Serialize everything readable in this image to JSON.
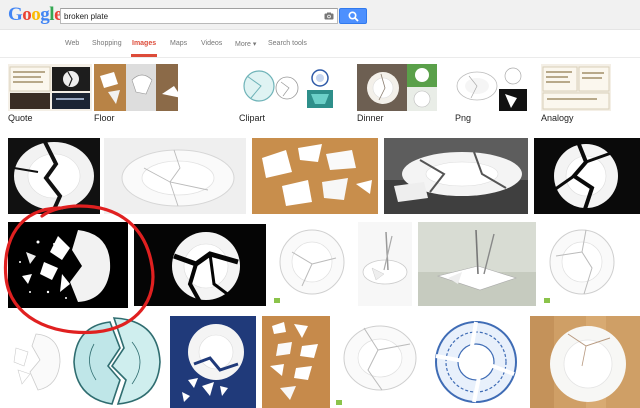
{
  "logo": {
    "letters": [
      "G",
      "o",
      "o",
      "g",
      "l",
      "e"
    ],
    "colors": [
      "#4285f4",
      "#ea4335",
      "#fbbc05",
      "#4285f4",
      "#34a853",
      "#ea4335"
    ]
  },
  "search": {
    "query": "broken plate",
    "camera_icon": "camera-icon",
    "button_icon": "search-icon"
  },
  "nav": {
    "items": [
      "Web",
      "Shopping",
      "Images",
      "Maps",
      "Videos",
      "More ▾",
      "Search tools"
    ],
    "active": "Images",
    "active_color": "#dd4b39"
  },
  "suggestions": [
    {
      "label": "Quote"
    },
    {
      "label": "Floor"
    },
    {
      "label": "Clipart"
    },
    {
      "label": "Dinner"
    },
    {
      "label": "Png"
    },
    {
      "label": "Analogy"
    }
  ],
  "annotation": {
    "color": "#e02020",
    "shape": "hand-drawn circle around image"
  },
  "accent_color": "#4d90fe"
}
